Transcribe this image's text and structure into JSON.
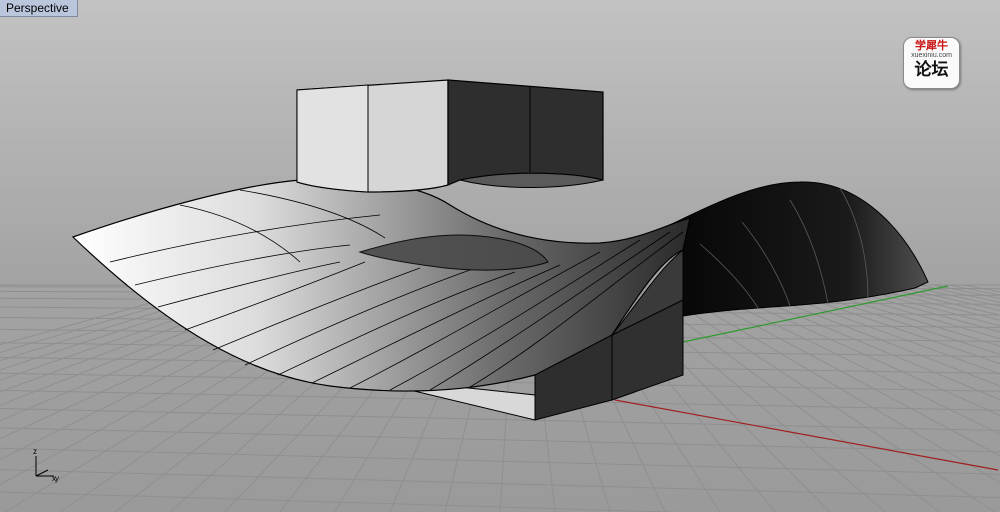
{
  "viewport": {
    "title": "Perspective"
  },
  "watermark": {
    "line1": "学犀牛",
    "line2": "xuexiniu.com",
    "line3": "论坛"
  },
  "axis_icon": {
    "z_label": "z",
    "x_label": "x",
    "y_label": "y"
  },
  "colors": {
    "background": "#9c9c9c",
    "grid_line": "#8c8c8c",
    "x_axis": "#a02020",
    "y_axis": "#2e9a2e",
    "label_bg": "#b9c6dc"
  }
}
